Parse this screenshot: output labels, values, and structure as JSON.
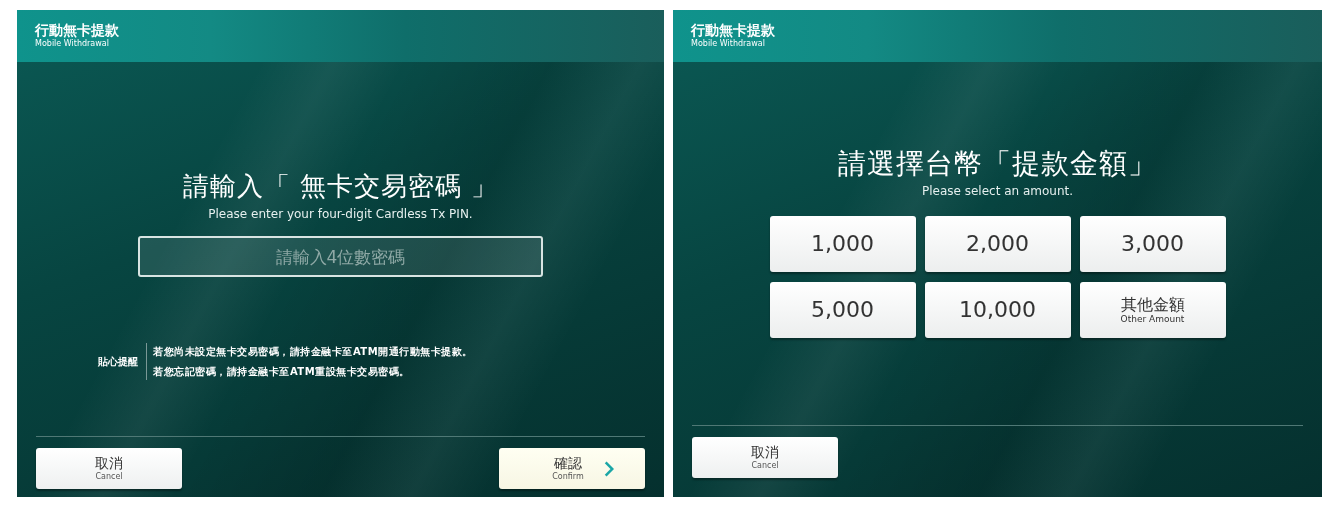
{
  "screens": [
    {
      "header": {
        "title": "行動無卡提款",
        "subtitle": "Mobile Withdrawal"
      },
      "heading": "請輸入「 無卡交易密碼 」",
      "subheading": "Please enter your four-digit Cardless Tx PIN.",
      "pin_field": {
        "placeholder": "請輸入4位數密碼"
      },
      "tip": {
        "label": "貼心提醒",
        "lines": [
          "若您尚未設定無卡交易密碼，請持金融卡至ATM開通行動無卡提款。",
          "若您忘記密碼，請持金融卡至ATM重設無卡交易密碼。"
        ]
      },
      "buttons": [
        {
          "kind": "cancel",
          "label": "取消",
          "sublabel": "Cancel"
        },
        {
          "kind": "confirm",
          "label": "確認",
          "sublabel": "Confirm"
        }
      ]
    },
    {
      "header": {
        "title": "行動無卡提款",
        "subtitle": "Mobile Withdrawal"
      },
      "heading": "請選擇台幣「提款金額」",
      "subheading": "Please select an amount.",
      "amounts": [
        {
          "label": "1,000"
        },
        {
          "label": "2,000"
        },
        {
          "label": "3,000"
        },
        {
          "label": "5,000"
        },
        {
          "label": "10,000"
        },
        {
          "label": "其他金額",
          "sublabel": "Other Amount"
        }
      ],
      "buttons": [
        {
          "kind": "cancel",
          "label": "取消",
          "sublabel": "Cancel"
        }
      ]
    }
  ]
}
